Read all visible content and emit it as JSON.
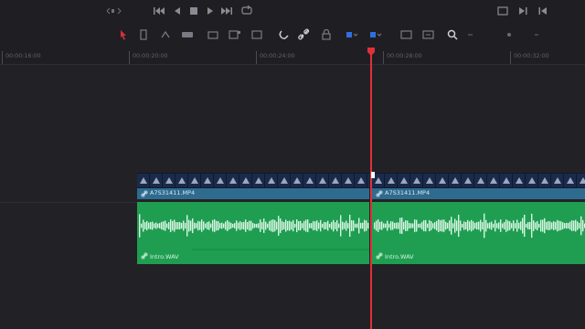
{
  "transport": {
    "buttons": [
      "prev-clip-icon",
      "jump-to-start-icon",
      "play-reverse-icon",
      "stop-icon",
      "play-icon",
      "jump-to-end-icon",
      "loop-icon"
    ]
  },
  "toolbar": {
    "tools": [
      "selection-tool-icon",
      "trim-tool-icon",
      "dynamic-trim-icon",
      "blade-tool-icon",
      "insert-clip-icon",
      "overwrite-clip-icon",
      "replace-clip-icon",
      "snapping-icon",
      "linked-selection-icon",
      "position-lock-icon",
      "flag-icon",
      "marker-icon",
      "zoom-full-icon",
      "zoom-detail-icon",
      "zoom-custom-icon"
    ]
  },
  "ruler": {
    "timecodes": [
      "00:00:16:00",
      "00:00:20:00",
      "00:00:24:00",
      "00:00:28:00",
      "00:00:32:00"
    ]
  },
  "video_clips": [
    {
      "name": "A7S31411.MP4"
    },
    {
      "name": "A7S31411.MP4"
    }
  ],
  "audio_clips": [
    {
      "name": "Intro.WAV"
    },
    {
      "name": "Intro.WAV"
    }
  ],
  "colors": {
    "background": "#1f1f23",
    "playhead": "#e0303a",
    "video_clip": "#2e6b8e",
    "audio_clip": "#1f9e51",
    "tool_active": "#2f6fe0"
  }
}
